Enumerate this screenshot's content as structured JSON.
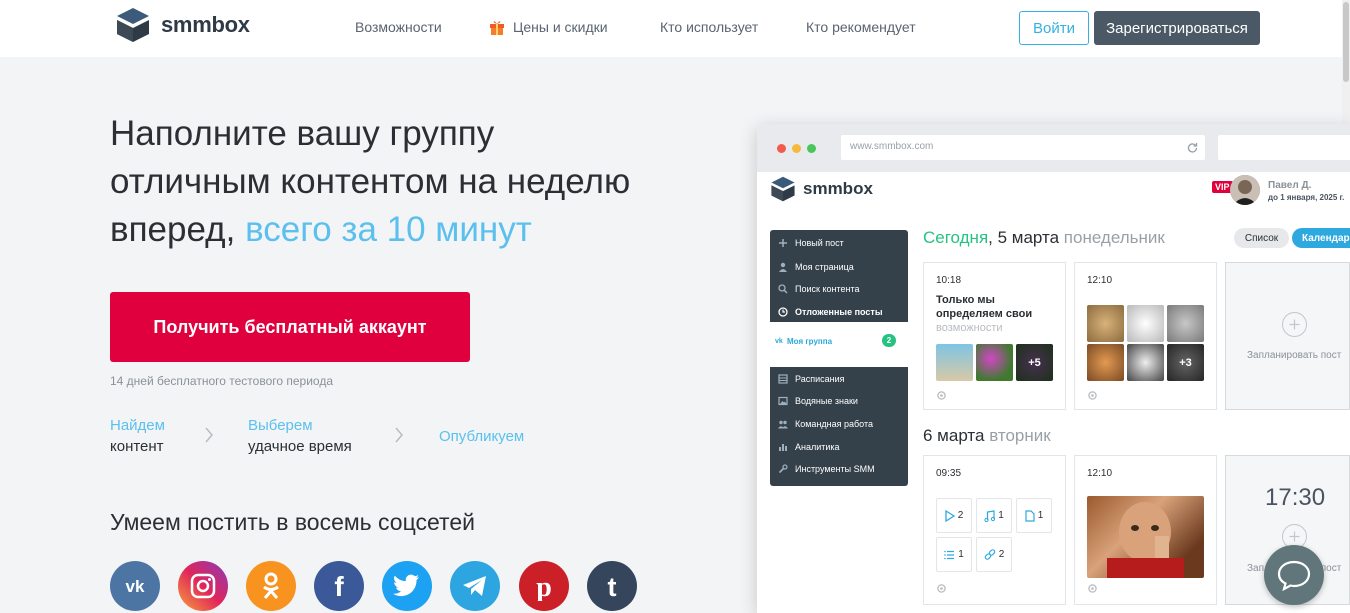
{
  "brand": {
    "name": "smmbox"
  },
  "nav": {
    "items": [
      {
        "label": "Возможности"
      },
      {
        "label": "Цены и скидки"
      },
      {
        "label": "Кто использует"
      },
      {
        "label": "Кто рекомендует"
      }
    ],
    "login_label": "Войти",
    "register_label": "Зарегистрироваться"
  },
  "hero": {
    "title_line1": "Наполните вашу группу",
    "title_line2": "отличным контентом на неделю",
    "title_line3_plain": "вперед,",
    "title_line3_accent": "всего за 10 минут",
    "cta_label": "Получить бесплатный аккаунт",
    "trial_note": "14 дней бесплатного тестового периода",
    "steps": [
      {
        "top": "Найдем",
        "bottom": "контент"
      },
      {
        "top": "Выберем",
        "bottom": "удачное время"
      },
      {
        "top": "Опубликуем",
        "bottom": ""
      }
    ],
    "social_title": "Умеем постить в восемь соцсетей",
    "socials": [
      "vk-icon",
      "instagram-icon",
      "odnoklassniki-icon",
      "facebook-icon",
      "twitter-icon",
      "telegram-icon",
      "pinterest-icon",
      "tumblr-icon"
    ],
    "social_colors": [
      "#4c75a3",
      "#c13584",
      "#f7931e",
      "#3b5998",
      "#1da1f2",
      "#2ca5e0",
      "#cb2027",
      "#35465c"
    ]
  },
  "mock": {
    "url": "www.smmbox.com",
    "logo_text": "smmbox",
    "vip_label": "VIP",
    "user_name": "Павел Д.",
    "user_sub": "до 1 января, 2025 г.",
    "sidebar": [
      {
        "label": "Новый пост",
        "icon": "plus-icon"
      },
      {
        "label": "Моя страница",
        "icon": "user-icon"
      },
      {
        "label": "Поиск контента",
        "icon": "search-icon"
      },
      {
        "label": "Отложенные посты",
        "icon": "clock-icon"
      },
      {
        "label": "Расписания",
        "icon": "grid-icon"
      },
      {
        "label": "Водяные знаки",
        "icon": "image-icon"
      },
      {
        "label": "Командная работа",
        "icon": "team-icon"
      },
      {
        "label": "Аналитика",
        "icon": "chart-icon"
      },
      {
        "label": "Инструменты SMM",
        "icon": "wrench-icon"
      }
    ],
    "group": {
      "label": "Моя группа",
      "network": "vk",
      "count": "2"
    },
    "today": {
      "a": "Сегодня",
      "b": ", 5 марта",
      "c": "понедельник"
    },
    "view_list": "Список",
    "view_calendar": "Календарь",
    "tomorrow": {
      "a": "6 марта",
      "b": "вторник"
    },
    "card1": {
      "time": "10:18",
      "text_a": "Только мы",
      "text_b": "определяем свои",
      "text_c": "возможности",
      "more": "+5"
    },
    "card2": {
      "time": "12:10",
      "more": "+3"
    },
    "card3": {
      "label": "Запланировать пост"
    },
    "card4": {
      "time": "09:35",
      "tiles": [
        {
          "icon": "video-icon",
          "n": "2"
        },
        {
          "icon": "music-icon",
          "n": "1"
        },
        {
          "icon": "doc-icon",
          "n": "1"
        },
        {
          "icon": "list-icon",
          "n": "1"
        },
        {
          "icon": "link-icon",
          "n": "2"
        }
      ]
    },
    "card5": {
      "time": "12:10"
    },
    "card6": {
      "time": "17:30",
      "label": "Запланировать пост"
    }
  }
}
